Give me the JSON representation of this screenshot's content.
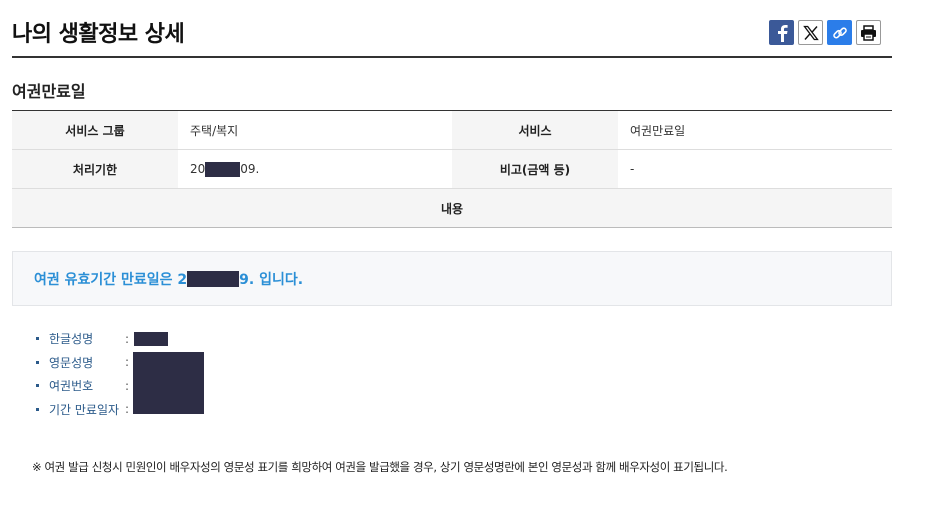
{
  "page": {
    "title": "나의 생활정보 상세"
  },
  "share": {
    "icons": [
      "facebook-icon",
      "x-icon",
      "link-icon",
      "print-icon"
    ]
  },
  "section": {
    "title": "여권만료일"
  },
  "info_table": {
    "service_group_label": "서비스 그룹",
    "service_group_value": "주택/복지",
    "service_label": "서비스",
    "service_value": "여권만료일",
    "deadline_label": "처리기한",
    "deadline_prefix": "20",
    "deadline_suffix": "09.",
    "note_label": "비고(금액 등)",
    "note_value": "-",
    "content_label": "내용"
  },
  "notice": {
    "prefix": "여권 유효기간 만료일은 2",
    "suffix": "9. 입니다.",
    "color": "#2b8fd6"
  },
  "details": {
    "separator": ":",
    "items": [
      {
        "label": "한글성명"
      },
      {
        "label": "영문성명"
      },
      {
        "label": "여권번호"
      },
      {
        "label": "기간 만료일자"
      }
    ]
  },
  "footnote": "※ 여권 발급 신청시 민원인이 배우자성의 영문성 표기를 희망하여 여권을 발급했을 경우, 상기 영문성명란에 본인 영문성과 함께 배우자성이 표기됩니다.",
  "colors": {
    "redaction": "#2d2d45",
    "accent": "#2b8fd6"
  }
}
